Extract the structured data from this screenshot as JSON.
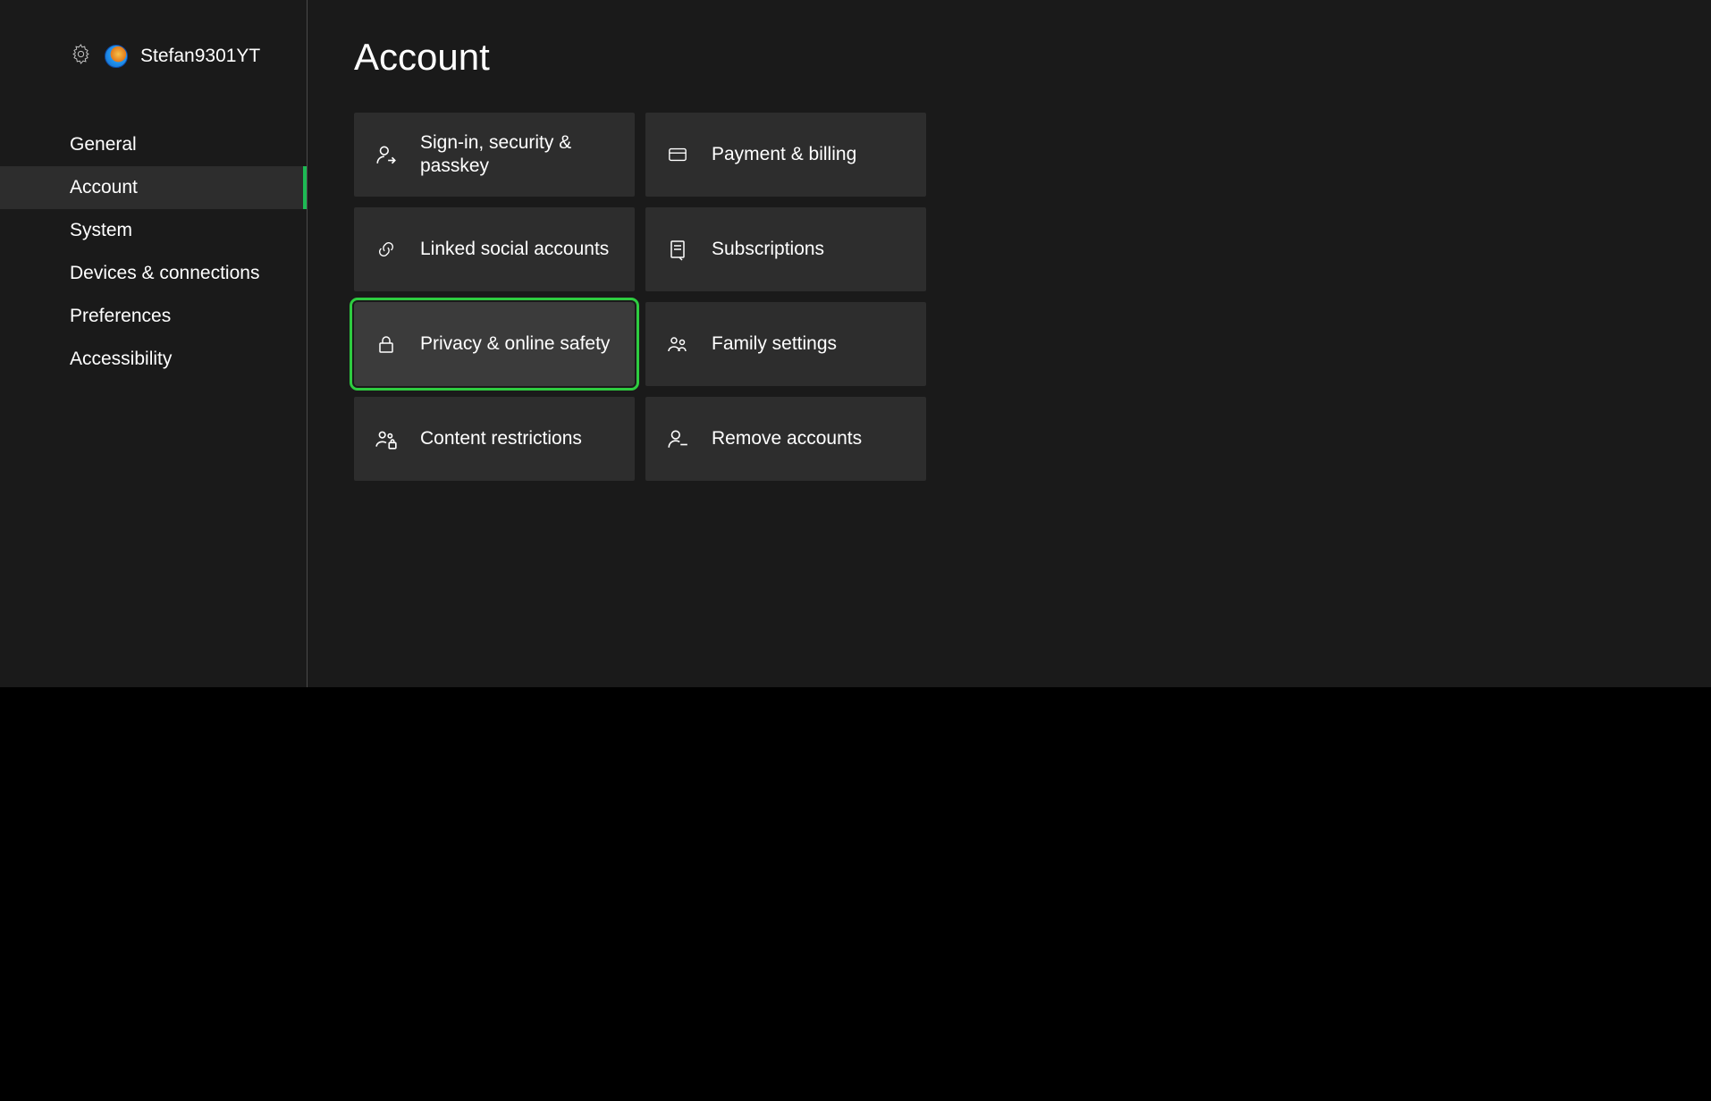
{
  "profile": {
    "name": "Stefan9301YT"
  },
  "sidebar": {
    "items": [
      {
        "label": "General",
        "active": false
      },
      {
        "label": "Account",
        "active": true
      },
      {
        "label": "System",
        "active": false
      },
      {
        "label": "Devices & connections",
        "active": false
      },
      {
        "label": "Preferences",
        "active": false
      },
      {
        "label": "Accessibility",
        "active": false
      }
    ]
  },
  "main": {
    "title": "Account",
    "tiles": [
      {
        "id": "signin",
        "label": "Sign-in, security & passkey",
        "icon": "person-arrow",
        "focused": false
      },
      {
        "id": "payment",
        "label": "Payment & billing",
        "icon": "credit-card",
        "focused": false
      },
      {
        "id": "linked",
        "label": "Linked social accounts",
        "icon": "link",
        "focused": false
      },
      {
        "id": "subscriptions",
        "label": "Subscriptions",
        "icon": "receipt",
        "focused": false
      },
      {
        "id": "privacy",
        "label": "Privacy & online safety",
        "icon": "lock",
        "focused": true
      },
      {
        "id": "family",
        "label": "Family settings",
        "icon": "people",
        "focused": false
      },
      {
        "id": "content",
        "label": "Content restrictions",
        "icon": "people-lock",
        "focused": false
      },
      {
        "id": "remove",
        "label": "Remove accounts",
        "icon": "person-minus",
        "focused": false
      }
    ]
  },
  "colors": {
    "background": "#1a1a1a",
    "tile": "#2d2d2d",
    "tile_focused": "#3b3b3b",
    "accent": "#2ecc40"
  }
}
